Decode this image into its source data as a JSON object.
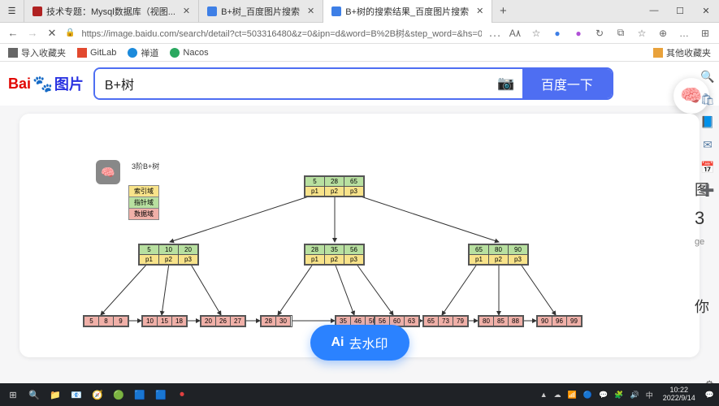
{
  "titlebar": {
    "tabs": [
      {
        "fav": "#b02222",
        "label": "技术专题：Mysql数据库（视图..."
      },
      {
        "fav": "#3e7fe6",
        "label": "B+树_百度图片搜索"
      },
      {
        "fav": "#3e7fe6",
        "label": "B+树的搜索结果_百度图片搜索"
      }
    ],
    "win": {
      "min": "—",
      "max": "☐",
      "close": "✕"
    },
    "newtab": "+"
  },
  "urlbar": {
    "back": "←",
    "fwd": "→",
    "stop": "✕",
    "lock": "🔒",
    "url": "https://image.baidu.com/search/detail?ct=503316480&z=0&ipn=d&word=B%2B树&step_word=&hs=0&pn...",
    "more": "…",
    "icons": [
      "A٨",
      "☆",
      "●",
      "●",
      "↻",
      "⧉",
      "☆",
      "⊕",
      "…",
      "⊞"
    ]
  },
  "bookmarks": {
    "items": [
      {
        "ico": "#666",
        "label": "导入收藏夹"
      },
      {
        "ico": "#e2492f",
        "label": "GitLab"
      },
      {
        "ico": "#1c8adb",
        "label": "禅道"
      },
      {
        "ico": "#2aa860",
        "label": "Nacos"
      }
    ],
    "other": {
      "ico": "#e9a23b",
      "label": "其他收藏夹"
    }
  },
  "baidu": {
    "logo1": "Bai",
    "paw": "🐾",
    "logo2": "图片",
    "query": "B+树",
    "button": "百度一下",
    "brain": "🧠"
  },
  "tree": {
    "title": "3阶B+树",
    "legend": [
      "索引域",
      "指针域",
      "数据域"
    ],
    "root": {
      "keys": [
        "5",
        "28",
        "65"
      ],
      "ptrs": [
        "p1",
        "p2",
        "p3"
      ]
    },
    "mids": [
      {
        "keys": [
          "5",
          "10",
          "20"
        ],
        "ptrs": [
          "p1",
          "p2",
          "p3"
        ]
      },
      {
        "keys": [
          "28",
          "35",
          "56"
        ],
        "ptrs": [
          "p1",
          "p2",
          "p3"
        ]
      },
      {
        "keys": [
          "65",
          "80",
          "90"
        ],
        "ptrs": [
          "p1",
          "p2",
          "p3"
        ]
      }
    ],
    "leaves": [
      [
        "5",
        "8",
        "9"
      ],
      [
        "10",
        "15",
        "18"
      ],
      [
        "20",
        "26",
        "27"
      ],
      [
        "28",
        "30",
        ""
      ],
      [
        "35",
        "46",
        "50"
      ],
      [
        "56",
        "60",
        "63"
      ],
      [
        "65",
        "73",
        "79"
      ],
      [
        "80",
        "85",
        "88"
      ],
      [
        "90",
        "96",
        "99"
      ]
    ]
  },
  "ai_btn": {
    "prefix": "Ai",
    "label": "去水印"
  },
  "right_peek": [
    "图",
    "3",
    "ge",
    "你"
  ],
  "next": "›",
  "gear": "⚙",
  "taskbar": {
    "items": [
      "⊞",
      "🔍",
      "📁",
      "📧",
      "🧭",
      "🟢",
      "🟦",
      "🟦",
      "⏺"
    ],
    "tray": [
      "▲",
      "☁",
      "📶",
      "🔵",
      "💬",
      "🧩",
      "🔊",
      "中"
    ],
    "time": "10:22",
    "date": "2022/9/14"
  }
}
